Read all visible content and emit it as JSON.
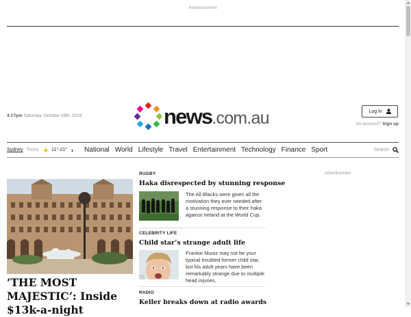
{
  "ads": {
    "top_label": "Advertisement",
    "right_label": "Advertisement"
  },
  "header": {
    "time": "4:17pm",
    "date": "Saturday, October 19th, 2019",
    "logo_main": "news",
    "logo_domain": ".com.au",
    "login_label": "Log in",
    "no_account_text": "No account?",
    "signup_label": "Sign up"
  },
  "nav": {
    "city": "Sydney",
    "today": "Today",
    "temps": "11°-21°",
    "chevron": "›",
    "items": [
      "National",
      "World",
      "Lifestyle",
      "Travel",
      "Entertainment",
      "Technology",
      "Finance",
      "Sport"
    ],
    "search_label": "Search"
  },
  "hero": {
    "title": "‘THE MOST MAJESTIC’: Inside $13k-a-night"
  },
  "stories": [
    {
      "category": "RUGBY",
      "title": "Haka disrespected by stunning response",
      "summary": "The All Blacks were given all the motivation they ever needed after a stunning response to their haka against Ireland at the World Cup."
    },
    {
      "category": "CELEBRITY LIFE",
      "title": "Child star’s strange adult life",
      "summary": "Frankie Muniz may not be your typical troubled former child star, but his adult years have been remarkably strange due to multiple head injuries."
    },
    {
      "category": "RADIO",
      "title": "Keller breaks down at radio awards",
      "summary": ""
    }
  ],
  "colors": {
    "logo_text": "#1a1a1a",
    "rule": "#555555",
    "muted": "#999999"
  }
}
